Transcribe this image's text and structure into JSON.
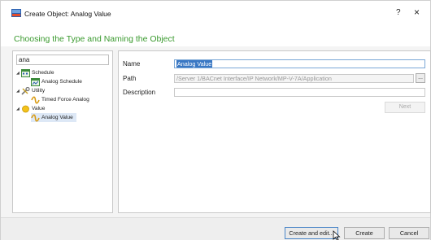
{
  "window": {
    "title": "Create Object: Analog Value",
    "help_glyph": "?",
    "close_glyph": "×"
  },
  "heading": "Choosing the Type and Naming the Object",
  "search": {
    "value": "ana"
  },
  "tree": [
    {
      "label": "Schedule",
      "expanded": true,
      "icon": "schedule-icon"
    },
    {
      "label": "Analog Schedule",
      "icon": "analog-schedule-icon"
    },
    {
      "label": "Utility",
      "expanded": true,
      "icon": "utility-icon"
    },
    {
      "label": "Timed Force Analog",
      "icon": "analog-wave-icon"
    },
    {
      "label": "Value",
      "expanded": true,
      "icon": "value-icon"
    },
    {
      "label": "Analog Value",
      "icon": "analog-wave-icon",
      "selected": true
    }
  ],
  "form": {
    "name_label": "Name",
    "name_value": "Analog Value",
    "path_label": "Path",
    "path_value": "/Server 1/BACnet Interface/IP Network/MP-V-7A/Application",
    "browse_label": "...",
    "description_label": "Description",
    "description_value": "",
    "next_label": "Next"
  },
  "footer": {
    "create_edit_label": "Create and edit...",
    "create_label": "Create",
    "cancel_label": "Cancel"
  },
  "colors": {
    "heading": "#3a9a2e",
    "selection": "#3a78c4",
    "tree_selected_bg": "#dde8f6"
  }
}
